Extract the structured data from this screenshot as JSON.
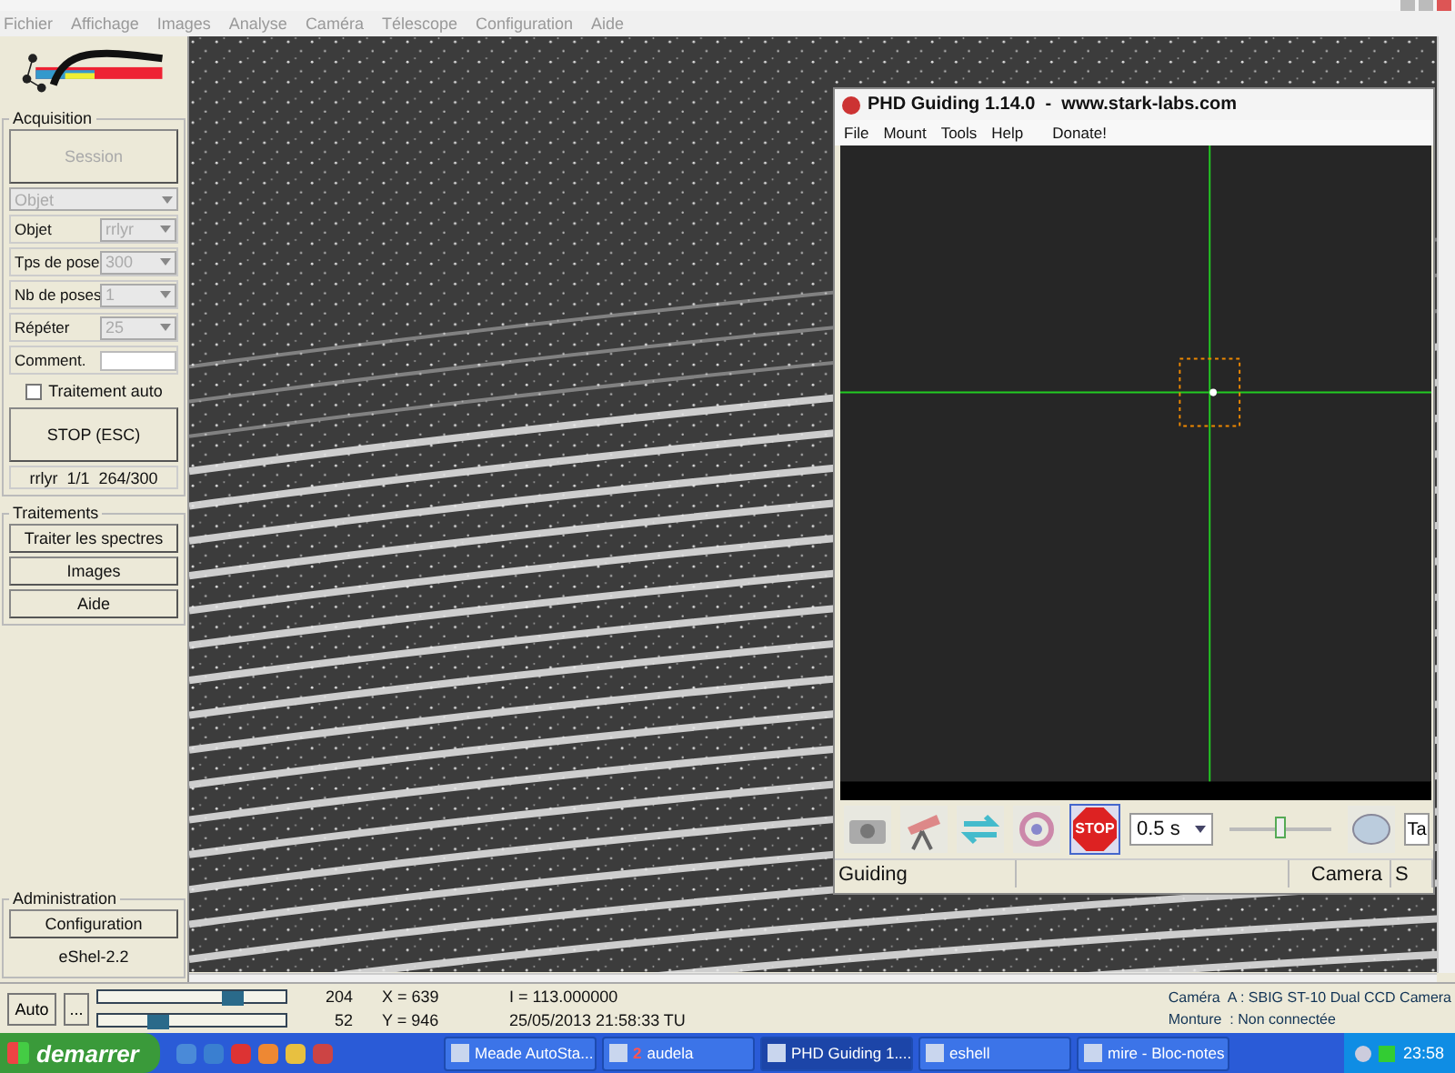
{
  "menu": [
    "Fichier",
    "Affichage",
    "Images",
    "Analyse",
    "Caméra",
    "Télescope",
    "Configuration",
    "Aide"
  ],
  "acquisition": {
    "title": "Acquisition",
    "session_button": {
      "label": "Session",
      "disabled": true
    },
    "object_combo": "Objet",
    "fields": [
      {
        "label": "Objet",
        "value": "rrlyr",
        "disabled": true
      },
      {
        "label": "Tps de pose",
        "value": "300",
        "disabled": true
      },
      {
        "label": "Nb de poses",
        "value": "1",
        "disabled": true
      },
      {
        "label": "Répéter",
        "value": "25",
        "disabled": true
      }
    ],
    "comment_label": "Comment.",
    "auto": {
      "label": "Traitement auto",
      "checked": false
    },
    "stop_button": "STOP (ESC)",
    "progress": "rrlyr  1/1  264/300"
  },
  "traitements": {
    "title": "Traitements",
    "buttons": [
      "Traiter les spectres",
      "Images",
      "Aide"
    ]
  },
  "administration": {
    "title": "Administration",
    "button": "Configuration",
    "version": "eShel-2.2"
  },
  "phd": {
    "title": "PHD Guiding 1.14.0  -  www.stark-labs.com",
    "menu": [
      "File",
      "Mount",
      "Tools",
      "Help",
      "Donate!"
    ],
    "stop_label": "STOP",
    "exposure": "0.5 s",
    "slider": {
      "level": 0.5
    },
    "cut_button": "Ta",
    "status": {
      "left": "Guiding",
      "camera": "Camera",
      "cut": "S"
    }
  },
  "status": {
    "auto_button": "Auto",
    "more_button": "...",
    "sliders": [
      {
        "level": 0.7,
        "value": "204",
        "coord": "X = 639"
      },
      {
        "level": 0.28,
        "value": "52",
        "coord": "Y = 946"
      }
    ],
    "intensity": "I = 113.000000",
    "datetime": "25/05/2013 21:58:33 TU",
    "camera": "Caméra  A : SBIG ST-10 Dual CCD Camera",
    "mount": "Monture  : Non connectée"
  },
  "taskbar": {
    "start": "demarrer",
    "tasks": [
      {
        "label": "Meade AutoSta...",
        "selected": false
      },
      {
        "label": "audela",
        "badge": "2",
        "selected": false
      },
      {
        "label": "PHD Guiding 1....",
        "selected": true
      },
      {
        "label": "eshell",
        "selected": false
      },
      {
        "label": "mire - Bloc-notes",
        "selected": false
      }
    ],
    "clock": "23:58"
  }
}
